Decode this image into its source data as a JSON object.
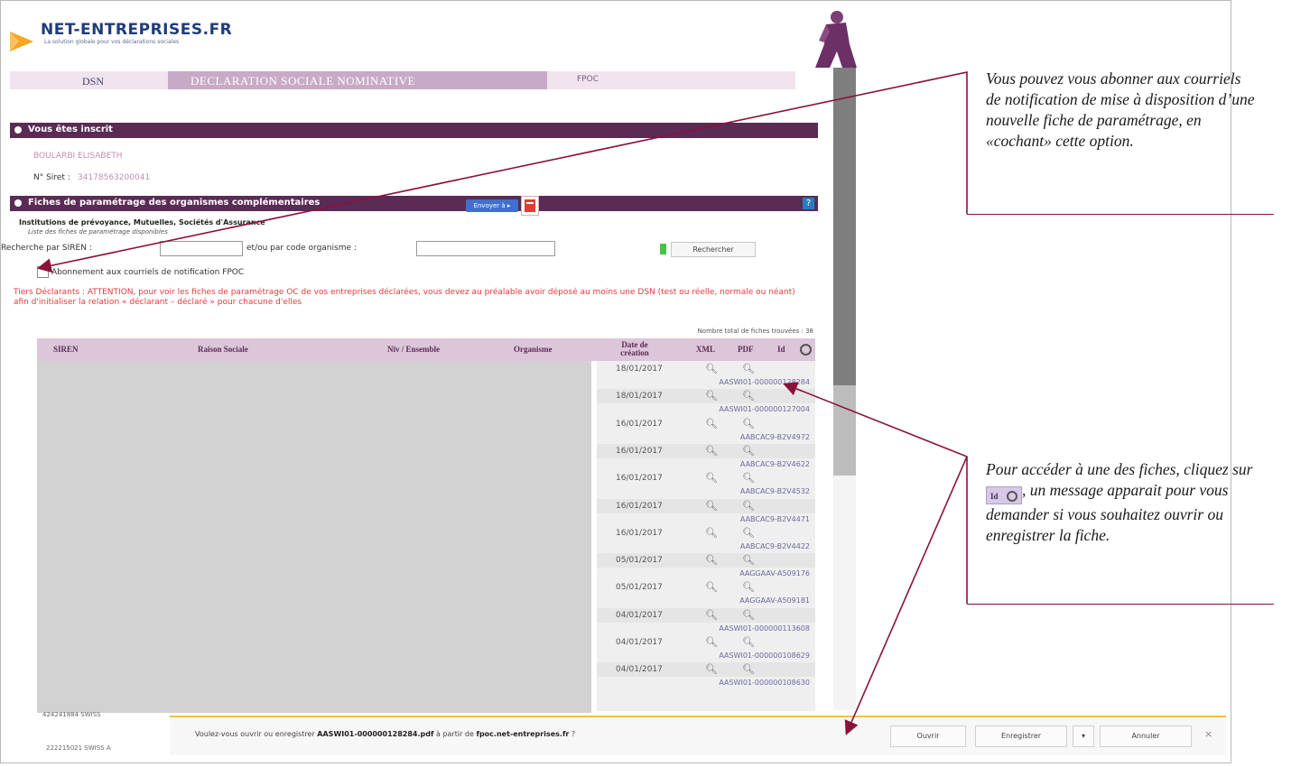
{
  "header": {
    "brand_name": "NET-ENTREPRISES.FR",
    "brand_tagline": "La solution globale pour vos déclarations sociales"
  },
  "nav": {
    "dsn": "DSN",
    "declaration": "DECLARATION SOCIALE NOMINATIVE",
    "fpoc": "FPOC"
  },
  "section_registered": {
    "title": "Vous êtes inscrit",
    "user_name": "BOULARBI ELISABETH",
    "siret_label": "N° Siret :",
    "siret_value": "34178563200041"
  },
  "section_fiches": {
    "title": "Fiches de paramétrage des organismes complémentaires",
    "send_button": "Envoyer à ▸",
    "help": "?",
    "institutions_title": "Institutions de prévoyance, Mutuelles, Sociétés d'Assurance",
    "institutions_sub": "Liste des fiches de paramétrage disponibles",
    "search_siren_label": "Recherche par SIREN :",
    "search_code_label": "et/ou par code organisme :",
    "search_button": "Rechercher",
    "subscribe_label": "Abonnement aux courriels de notification FPOC",
    "warning": "Tiers Déclarants : ATTENTION, pour voir les fiches de paramétrage OC de vos entreprises déclarées, vous devez au préalable avoir déposé au moins une DSN (test ou réelle, normale ou néant) afin d'initialiser la relation « déclarant – déclaré » pour chacune d'elles",
    "total_label": "Nombre total de fiches trouvées : 38"
  },
  "table": {
    "headers": {
      "siren": "SIREN",
      "raison_sociale": "Raison Sociale",
      "niv": "Niv / Ensemble",
      "organisme": "Organisme",
      "date": "Date de création",
      "xml": "XML",
      "pdf": "PDF",
      "id": "Id"
    },
    "rows": [
      {
        "date": "18/01/2017",
        "ref": "AASWI01-000000128284"
      },
      {
        "date": "18/01/2017",
        "ref": "AASWI01-000000127004"
      },
      {
        "date": "16/01/2017",
        "ref": "AABCAC9-B2V4972"
      },
      {
        "date": "16/01/2017",
        "ref": "AABCAC9-B2V4622"
      },
      {
        "date": "16/01/2017",
        "ref": "AABCAC9-B2V4532"
      },
      {
        "date": "16/01/2017",
        "ref": "AABCAC9-B2V4471"
      },
      {
        "date": "16/01/2017",
        "ref": "AABCAC9-B2V4422"
      },
      {
        "date": "05/01/2017",
        "ref": "AAGGAAV-A509176"
      },
      {
        "date": "05/01/2017",
        "ref": "AAGGAAV-A509181"
      },
      {
        "date": "04/01/2017",
        "ref": "AASWI01-000000113608"
      },
      {
        "date": "04/01/2017",
        "ref": "AASWI01-000000108629"
      },
      {
        "date": "04/01/2017",
        "ref": "AASWI01-000000108630"
      }
    ],
    "extra_row_1": "424241884 SWISS",
    "extra_row_2": "222215021 SWISS A"
  },
  "download_bar": {
    "message_prefix": "Voulez-vous ouvrir ou enregistrer",
    "filename": "AASWI01-000000128284.pdf",
    "message_mid": "à partir de",
    "domain": "fpoc.net-entreprises.fr",
    "message_suffix": "?",
    "open": "Ouvrir",
    "save": "Enregistrer",
    "save_dropdown": "▾",
    "cancel": "Annuler",
    "close": "×"
  },
  "annotations": {
    "note1": "Vous pouvez vous abonner aux courriels de notification de mise à disposition d’une nouvelle fiche de paramétrage, en «cochant» cette option.",
    "note2_before": "Pour accéder à une des fiches, cliquez sur",
    "note2_badge": "Id",
    "note2_after": ", un message apparait pour vous demander si vous souhaitez ouvrir ou enregistrer la fiche."
  },
  "colors": {
    "section_bar": "#5a2b55",
    "annotation_line": "#8a1238",
    "warning_text": "#e23a3a"
  }
}
